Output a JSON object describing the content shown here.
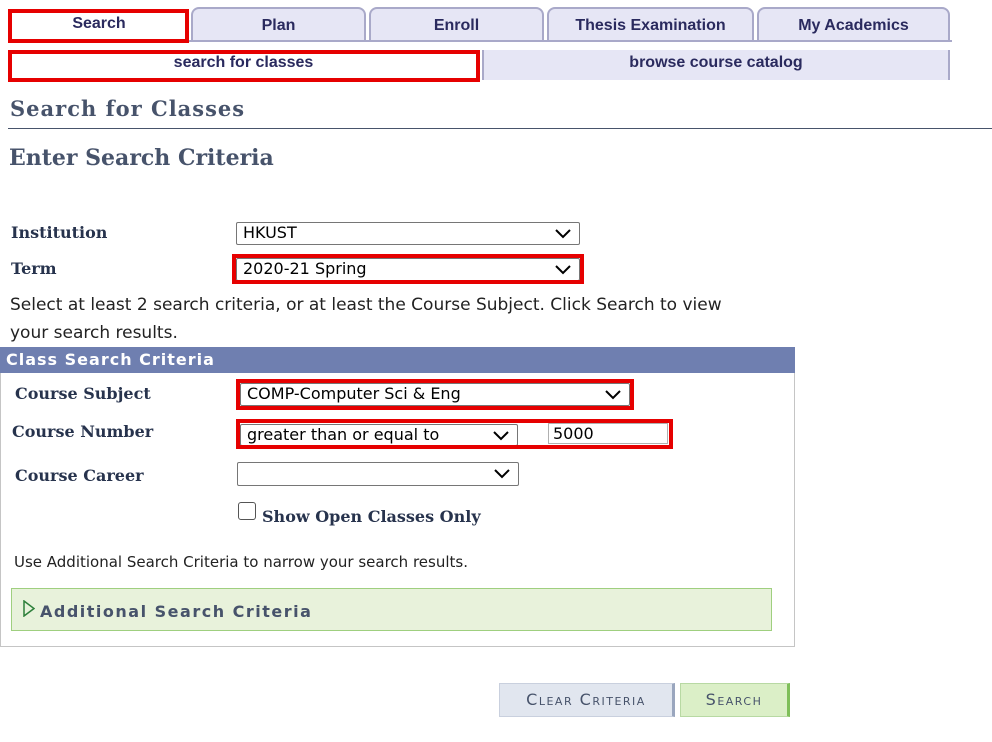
{
  "tabs": [
    {
      "label": "Search"
    },
    {
      "label": "Plan"
    },
    {
      "label": "Enroll"
    },
    {
      "label": "Thesis Examination"
    },
    {
      "label": "My Academics"
    }
  ],
  "subtabs": {
    "search_for_classes": "search for classes",
    "browse_catalog": "browse course catalog"
  },
  "page_title": "Search for Classes",
  "section_title": "Enter Search Criteria",
  "institution": {
    "label": "Institution",
    "value": "HKUST"
  },
  "term": {
    "label": "Term",
    "value": "2020-21 Spring"
  },
  "instructions": "Select at least 2 search criteria, or at least the Course Subject. Click Search to view your search results.",
  "criteria_header": "Class Search Criteria",
  "course_subject": {
    "label": "Course Subject",
    "value": "COMP-Computer Sci & Eng"
  },
  "course_number": {
    "label": "Course Number",
    "operator": "greater than or equal to",
    "value": "5000"
  },
  "course_career": {
    "label": "Course Career",
    "value": ""
  },
  "open_only": {
    "label": "Show Open Classes Only",
    "checked": false
  },
  "additional_hint": "Use Additional Search Criteria to narrow your search results.",
  "additional_label": "Additional Search Criteria",
  "buttons": {
    "clear": "Clear Criteria",
    "search": "Search"
  },
  "colors": {
    "highlight": "#e60000",
    "header": "#6f7fb0",
    "heading": "#47536b"
  }
}
